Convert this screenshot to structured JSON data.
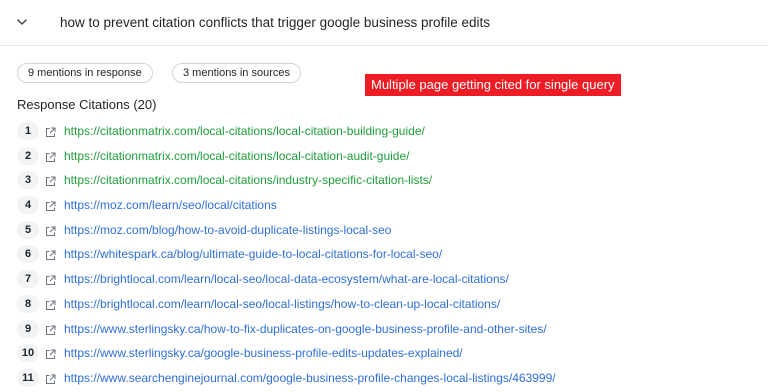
{
  "header": {
    "chevron_icon": "chevron-down-icon",
    "query": "how to prevent citation conflicts that trigger google business profile edits"
  },
  "stats": {
    "mentions_response": "9 mentions in response",
    "mentions_sources": "3 mentions in sources"
  },
  "annotation": {
    "text": "Multiple page getting cited for single query",
    "color": "#ee1c24"
  },
  "citations": {
    "title": "Response Citations (20)",
    "link_icon": "external-link-icon",
    "colors": {
      "highlighted": "#1e9e3a",
      "normal": "#2f6fd8"
    },
    "items": [
      {
        "num": "1",
        "url": "https://citationmatrix.com/local-citations/local-citation-building-guide/",
        "highlighted": true
      },
      {
        "num": "2",
        "url": "https://citationmatrix.com/local-citations/local-citation-audit-guide/",
        "highlighted": true
      },
      {
        "num": "3",
        "url": "https://citationmatrix.com/local-citations/industry-specific-citation-lists/",
        "highlighted": true
      },
      {
        "num": "4",
        "url": "https://moz.com/learn/seo/local/citations",
        "highlighted": false
      },
      {
        "num": "5",
        "url": "https://moz.com/blog/how-to-avoid-duplicate-listings-local-seo",
        "highlighted": false
      },
      {
        "num": "6",
        "url": "https://whitespark.ca/blog/ultimate-guide-to-local-citations-for-local-seo/",
        "highlighted": false
      },
      {
        "num": "7",
        "url": "https://brightlocal.com/learn/local-seo/local-data-ecosystem/what-are-local-citations/",
        "highlighted": false
      },
      {
        "num": "8",
        "url": "https://brightlocal.com/learn/local-seo/local-listings/how-to-clean-up-local-citations/",
        "highlighted": false
      },
      {
        "num": "9",
        "url": "https://www.sterlingsky.ca/how-to-fix-duplicates-on-google-business-profile-and-other-sites/",
        "highlighted": false
      },
      {
        "num": "10",
        "url": "https://www.sterlingsky.ca/google-business-profile-edits-updates-explained/",
        "highlighted": false
      },
      {
        "num": "11",
        "url": "https://www.searchenginejournal.com/google-business-profile-changes-local-listings/463999/",
        "highlighted": false
      }
    ]
  }
}
